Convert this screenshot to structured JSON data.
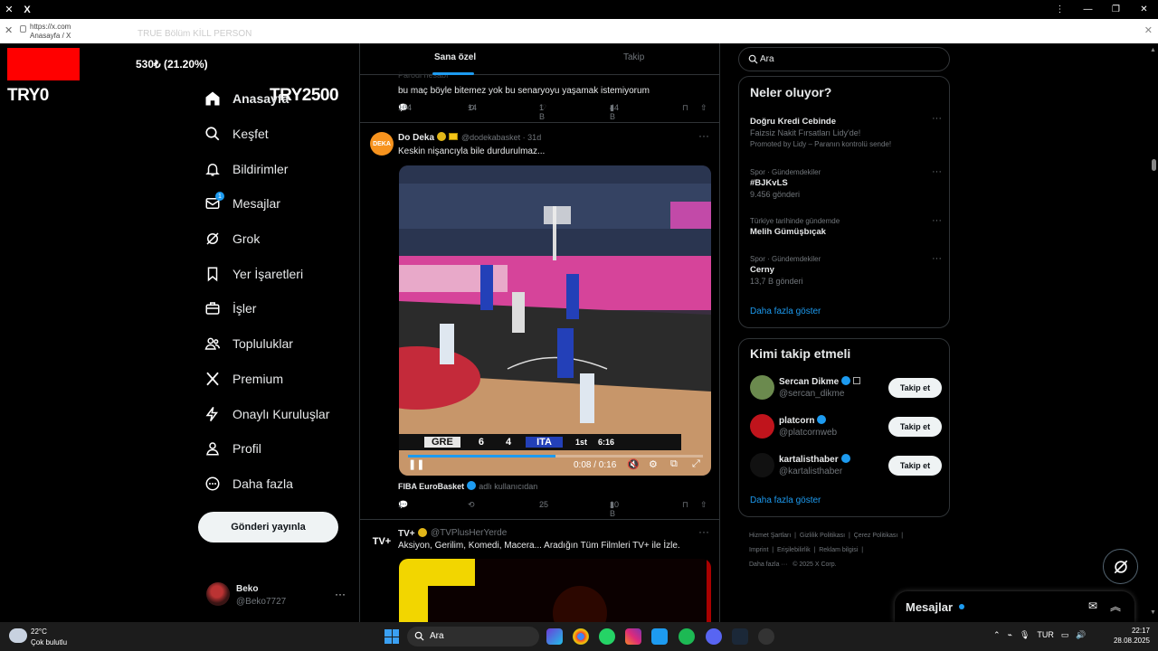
{
  "browser": {
    "url": "https://x.com",
    "page_title": "Anasayfa / X",
    "ghost_text": "TRUE Bölüm KİLL PERSON",
    "colors": {
      "bg": "#ffffff"
    }
  },
  "overlay": {
    "amount": "530₺ (21.20%)",
    "left_label": "TRY0",
    "right_label": "TRY2500",
    "bar_color": "#ff0000",
    "progress_percent": 21.2
  },
  "nav": {
    "items": [
      {
        "label": "Anasayfa",
        "icon": "home-icon",
        "active": true
      },
      {
        "label": "Keşfet",
        "icon": "search-icon"
      },
      {
        "label": "Bildirimler",
        "icon": "bell-icon"
      },
      {
        "label": "Mesajlar",
        "icon": "mail-icon",
        "badge": "1"
      },
      {
        "label": "Grok",
        "icon": "grok-icon"
      },
      {
        "label": "Yer İşaretleri",
        "icon": "bookmark-icon"
      },
      {
        "label": "İşler",
        "icon": "briefcase-icon"
      },
      {
        "label": "Topluluklar",
        "icon": "people-icon"
      },
      {
        "label": "Premium",
        "icon": "x-logo-icon"
      },
      {
        "label": "Onaylı Kuruluşlar",
        "icon": "lightning-icon"
      },
      {
        "label": "Profil",
        "icon": "person-icon"
      },
      {
        "label": "Daha fazla",
        "icon": "more-circle-icon"
      }
    ],
    "post_button": "Gönderi yayınla",
    "account": {
      "name": "Beko",
      "handle": "@Beko7727"
    }
  },
  "feed": {
    "tabs": [
      "Sana özel",
      "Takip"
    ],
    "post1": {
      "ghost_header": "Parodi hesabı",
      "text": "bu maç böyle bitemez yok bu senaryoyu yaşamak istemiyorum",
      "replies": "104",
      "reposts": "14",
      "likes": "1 B",
      "views": "44 B"
    },
    "post2": {
      "avatar_text": "DEKA",
      "name": "Do Deka",
      "handle": "@dodekabasket · 31d",
      "text": "Keskin nişancıyla bile durdurulmaz...",
      "video": {
        "time": "0:08 / 0:16",
        "progress_percent": 50,
        "scoreboard": {
          "team1": "GRE",
          "score1": "6",
          "score2": "4",
          "team2": "ITA",
          "quarter": "1st",
          "clock": "6:16"
        }
      },
      "source_name": "FIBA EuroBasket",
      "source_sub": "adlı kullanıcıdan",
      "replies": "1",
      "reposts": "",
      "likes": "25",
      "views": "10 B"
    },
    "post3": {
      "avatar_text": "TV+",
      "name": "TV+",
      "handle": "@TVPlusHerYerde",
      "text": "Aksiyon, Gerilim, Komedi, Macera... Aradığın Tüm Filmleri TV+ ile İzle."
    }
  },
  "right": {
    "search_value": "Ara",
    "trends_title": "Neler oluyor?",
    "trends": [
      {
        "category": "",
        "title": "Doğru Kredi Cebinde",
        "subtitle": "Faizsiz Nakit Fırsatları Lidy'de!",
        "promo": "Promoted by Lidy – Paranın kontrolü sende!"
      },
      {
        "category": "Spor · Gündemdekiler",
        "title": "#BJKvLS",
        "subtitle": "9.456 gönderi"
      },
      {
        "category": "Türkiye tarihinde gündemde",
        "title": "Melih Gümüşbıçak",
        "subtitle": ""
      },
      {
        "category": "Spor · Gündemdekiler",
        "title": "Cerny",
        "subtitle": "13,7 B gönderi"
      }
    ],
    "trends_more": "Daha fazla göster",
    "who_title": "Kimi takip etmeli",
    "who": [
      {
        "name": "Sercan Dikme",
        "handle": "@sercan_dikme",
        "button": "Takip et",
        "avatar_color": "#6b8a4e"
      },
      {
        "name": "platcorn",
        "handle": "@platcornweb",
        "button": "Takip et",
        "avatar_color": "#c0141c"
      },
      {
        "name": "kartalisthaber",
        "handle": "@kartalisthaber",
        "button": "Takip et",
        "avatar_color": "#111111"
      }
    ],
    "who_more": "Daha fazla göster",
    "footer": {
      "links": [
        "Hizmet Şartları",
        "Gizlilik Politikası",
        "Çerez Politikası",
        "Imprint",
        "Erişilebilirlik",
        "Reklam bilgisi",
        "Daha fazla ···"
      ],
      "copyright": "© 2025 X Corp."
    }
  },
  "messages_drawer": {
    "title": "Mesajlar"
  },
  "taskbar": {
    "weather_temp": "22°C",
    "weather_text": "Çok bulutlu",
    "search": "Ara",
    "lang": "TUR",
    "time": "22:17",
    "date": "28.08.2025"
  }
}
